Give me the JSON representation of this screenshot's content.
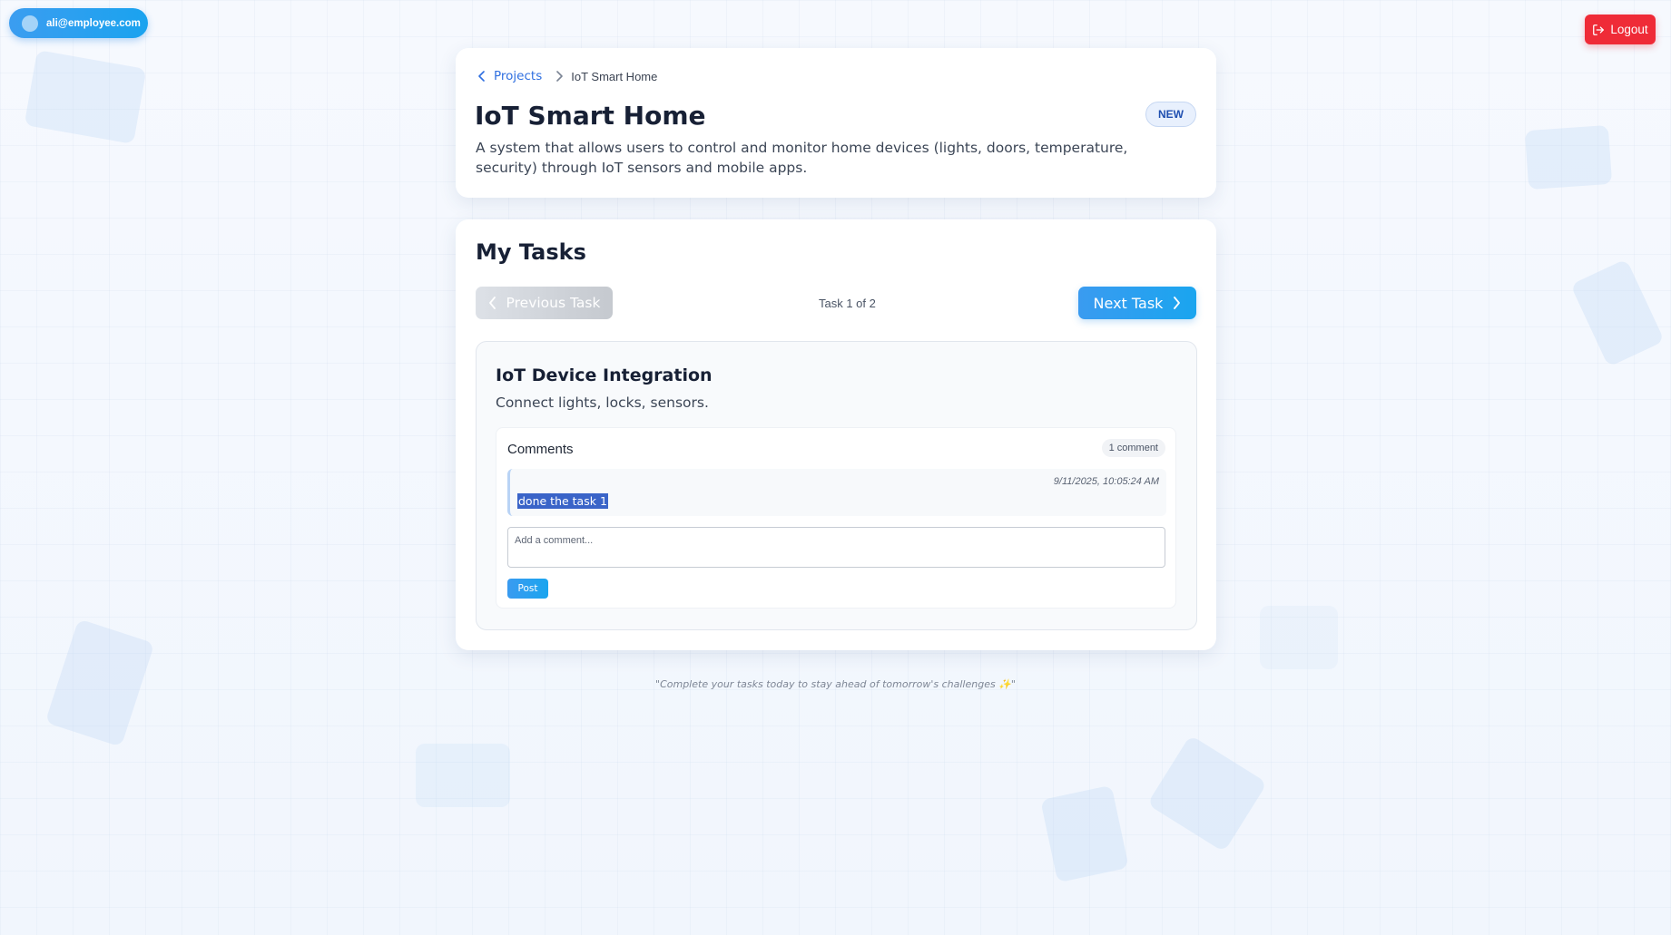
{
  "user": {
    "email": "ali@employee.com"
  },
  "header": {
    "logout_label": "Logout"
  },
  "breadcrumb": {
    "parent": "Projects",
    "current": "IoT Smart Home"
  },
  "project": {
    "title": "IoT Smart Home",
    "badge": "NEW",
    "description": "A system that allows users to control and monitor home devices (lights, doors, temperature, security) through IoT sensors and mobile apps."
  },
  "tasks": {
    "section_title": "My Tasks",
    "prev_label": "Previous Task",
    "next_label": "Next Task",
    "counter": "Task 1 of 2",
    "current": {
      "title": "IoT Device Integration",
      "description": "Connect lights, locks, sensors."
    }
  },
  "comments": {
    "title": "Comments",
    "count_label": "1 comment",
    "items": [
      {
        "timestamp": "9/11/2025, 10:05:24 AM",
        "text": "done the task 1"
      }
    ],
    "input_placeholder": "Add a comment...",
    "post_label": "Post"
  },
  "footer": {
    "quote": "\"Complete your tasks today to stay ahead of tomorrow's challenges ✨\""
  },
  "colors": {
    "accent": "#1aa5ef",
    "logout": "#ef2b37",
    "link": "#2f6fe0",
    "badge_bg": "#e8f0fd"
  },
  "icons": {
    "breadcrumb_back": "chevron-left-icon",
    "breadcrumb_separator": "chevron-right-icon",
    "logout": "logout-icon",
    "prev": "chevron-left-icon",
    "next": "chevron-right-icon"
  }
}
